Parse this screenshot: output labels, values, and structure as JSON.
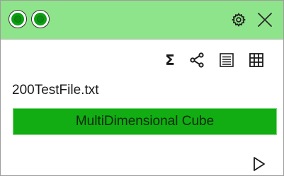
{
  "window": {
    "titlebar_color": "#8ee48a",
    "status_dots": [
      {
        "icon": "green-radio-dot",
        "color": "#0f9f14"
      },
      {
        "icon": "green-radio-dot",
        "color": "#0f9f14"
      }
    ],
    "settings_icon": "gear-icon",
    "close_icon": "close-icon"
  },
  "toolbar": {
    "icons": [
      "sigma-icon",
      "share-nodes-icon",
      "list-icon",
      "table-grid-icon"
    ],
    "sigma_glyph": "Σ"
  },
  "file": {
    "name": "200TestFile.txt"
  },
  "cube": {
    "label": "MultiDimensional Cube",
    "color": "#12ad12"
  },
  "actions": {
    "run_icon": "play-icon"
  }
}
